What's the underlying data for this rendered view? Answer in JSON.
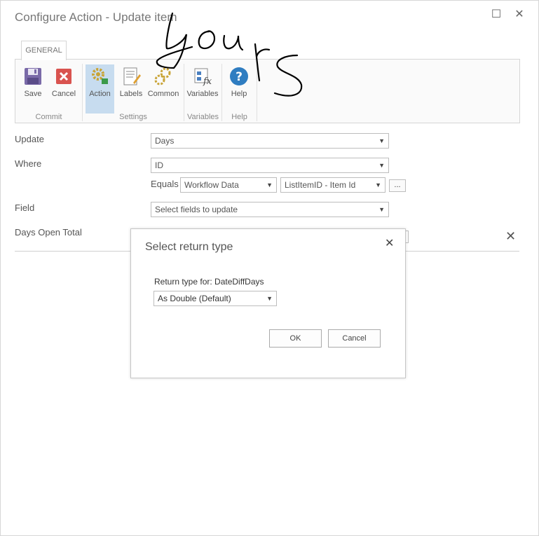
{
  "window": {
    "title": "Configure Action - Update item"
  },
  "ribbon": {
    "tab": "GENERAL",
    "buttons": {
      "save": "Save",
      "cancel": "Cancel",
      "action": "Action",
      "labels": "Labels",
      "common": "Common",
      "variables": "Variables",
      "help": "Help"
    },
    "groups": {
      "commit": "Commit",
      "settings": "Settings",
      "variables": "Variables",
      "help": "Help"
    }
  },
  "form": {
    "update_label": "Update",
    "update_value": "Days",
    "where_label": "Where",
    "where_value": "ID",
    "equals_label": "Equals",
    "equals_source": "Workflow Data",
    "equals_field": "ListItemID - Item Id",
    "ellipsis": "...",
    "field_label": "Field",
    "field_value": "Select fields to update",
    "days_open_label": "Days Open Total"
  },
  "dialog": {
    "title": "Select return type",
    "label": "Return type for: DateDiffDays",
    "select_value": "As Double (Default)",
    "ok": "OK",
    "cancel": "Cancel"
  },
  "colors": {
    "accent_active": "#c7dcef",
    "help_blue": "#2f7dc1",
    "cancel_red": "#d9534f",
    "save_purple": "#7a6aa8"
  }
}
